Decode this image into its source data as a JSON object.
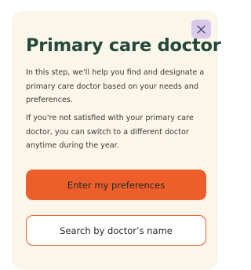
{
  "dialog": {
    "title": "Primary care doctor",
    "close_icon": "close-icon",
    "paragraphs": [
      "In this step, we'll help you find and designate a primary care doctor based on your needs and preferences.",
      "If you're not satisfied with your primary care doctor, you can switch to a different doctor anytime during the year."
    ],
    "primary_button_label": "Enter my preferences",
    "secondary_button_label": "Search by doctor’s name"
  },
  "colors": {
    "card_background": "#fbf6ea",
    "title": "#24483a",
    "accent": "#ee5e2b",
    "close_button_background": "#d9c9ea"
  }
}
